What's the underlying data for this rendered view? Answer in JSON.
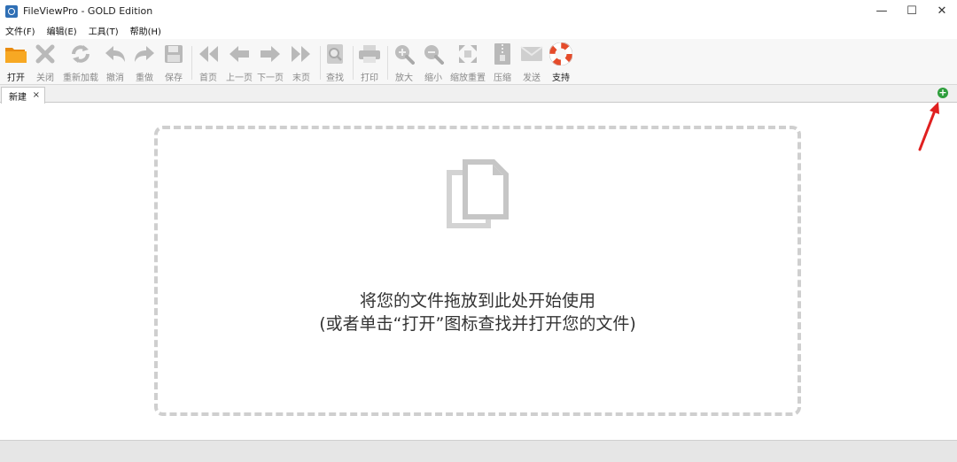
{
  "window": {
    "title": "FileViewPro - GOLD Edition",
    "controls": {
      "minimize": "—",
      "maximize": "☐",
      "close": "✕"
    }
  },
  "menu": [
    "文件(F)",
    "编辑(E)",
    "工具(T)",
    "帮助(H)"
  ],
  "toolbar": {
    "buttons": [
      {
        "label": "打开",
        "icon": "folder-open-icon",
        "enabled": true
      },
      {
        "label": "关闭",
        "icon": "close-x-icon",
        "enabled": false
      },
      {
        "label": "重新加载",
        "icon": "reload-icon",
        "enabled": false
      },
      {
        "label": "撤消",
        "icon": "undo-icon",
        "enabled": false
      },
      {
        "label": "重做",
        "icon": "redo-icon",
        "enabled": false
      },
      {
        "label": "保存",
        "icon": "floppy-save-icon",
        "enabled": false
      },
      {
        "label": "首页",
        "icon": "first-page-icon",
        "enabled": false
      },
      {
        "label": "上一页",
        "icon": "previous-page-icon",
        "enabled": false
      },
      {
        "label": "下一页",
        "icon": "next-page-icon",
        "enabled": false
      },
      {
        "label": "末页",
        "icon": "last-page-icon",
        "enabled": false
      },
      {
        "label": "查找",
        "icon": "find-icon",
        "enabled": false
      },
      {
        "label": "打印",
        "icon": "printer-icon",
        "enabled": false
      },
      {
        "label": "放大",
        "icon": "zoom-in-icon",
        "enabled": false
      },
      {
        "label": "缩小",
        "icon": "zoom-out-icon",
        "enabled": false
      },
      {
        "label": "缩放重置",
        "icon": "zoom-reset-icon",
        "enabled": false
      },
      {
        "label": "压缩",
        "icon": "compress-zip-icon",
        "enabled": false
      },
      {
        "label": "发送",
        "icon": "envelope-send-icon",
        "enabled": false
      },
      {
        "label": "支持",
        "icon": "lifebuoy-support-icon",
        "enabled": true
      }
    ]
  },
  "tabs": [
    {
      "label": "新建",
      "close": "×"
    }
  ],
  "add_tab_icon": "+",
  "dropzone": {
    "line1": "将您的文件拖放到此处开始使用",
    "line2": "(或者单击“打开”图标查找并打开您的文件)"
  },
  "colors": {
    "accent_green": "#2e9e3c",
    "annotation_red": "#e02020",
    "dashed_border": "#cfcfcf",
    "toolbar_bg": "#f7f7f7"
  }
}
